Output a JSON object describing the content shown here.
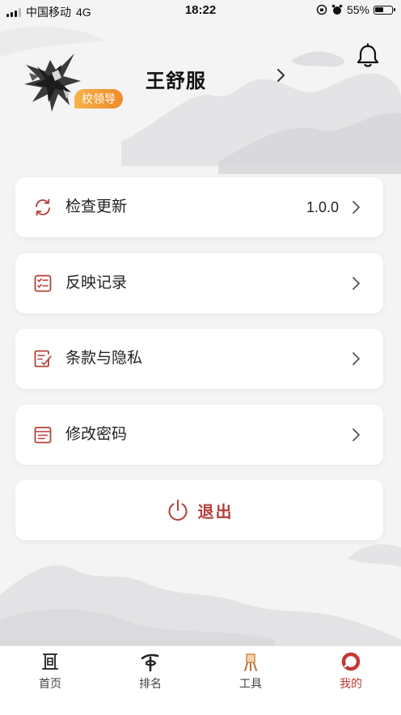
{
  "status_bar": {
    "carrier": "中国移动",
    "network": "4G",
    "time": "18:22",
    "battery_percent": "55%",
    "battery_level": 0.55
  },
  "profile": {
    "name": "王舒服",
    "role_badge": "校领导"
  },
  "menu": [
    {
      "label": "检查更新",
      "value": "1.0.0",
      "icon": "refresh-icon"
    },
    {
      "label": "反映记录",
      "value": "",
      "icon": "checklist-icon"
    },
    {
      "label": "条款与隐私",
      "value": "",
      "icon": "document-edit-icon"
    },
    {
      "label": "修改密码",
      "value": "",
      "icon": "notebook-icon"
    }
  ],
  "logout": {
    "label": "退出",
    "icon": "power-icon"
  },
  "tabbar": [
    {
      "label": "首页",
      "icon": "home-icon",
      "active": false
    },
    {
      "label": "排名",
      "icon": "ranking-icon",
      "active": false
    },
    {
      "label": "工具",
      "icon": "easel-icon",
      "active": false
    },
    {
      "label": "我的",
      "icon": "me-icon",
      "active": true
    }
  ],
  "colors": {
    "accent": "#c23a33",
    "icon_red": "#b3403a",
    "badge": "#f29a35",
    "background": "#f4f4f5"
  }
}
